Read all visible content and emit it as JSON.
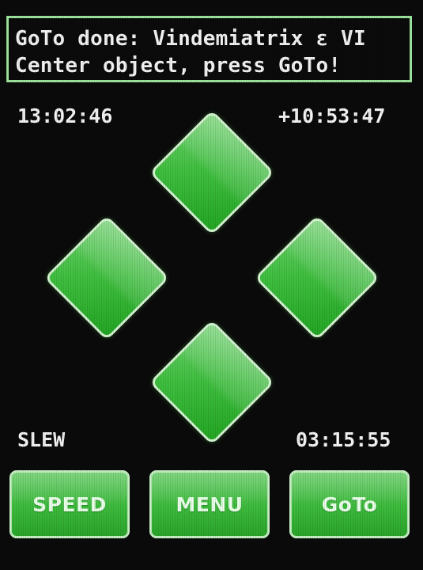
{
  "message": {
    "line1": "GoTo done: Vindemiatrix ε VI",
    "line2": "Center object, press GoTo!"
  },
  "time_left": "13:02:46",
  "coord_right": "+10:53:47",
  "mode": "SLEW",
  "time_bottom_right": "03:15:55",
  "buttons": {
    "speed": "SPEED",
    "menu": "MENU",
    "goto": "GoTo"
  },
  "colors": {
    "button_green": "#3fbf3f",
    "border_light_green": "#9be39b",
    "background": "#0a0a0a",
    "text": "#f4f4f4"
  },
  "icons": {
    "dpad_up": "up-arrow-diamond-icon",
    "dpad_left": "left-arrow-diamond-icon",
    "dpad_right": "right-arrow-diamond-icon",
    "dpad_down": "down-arrow-diamond-icon"
  }
}
